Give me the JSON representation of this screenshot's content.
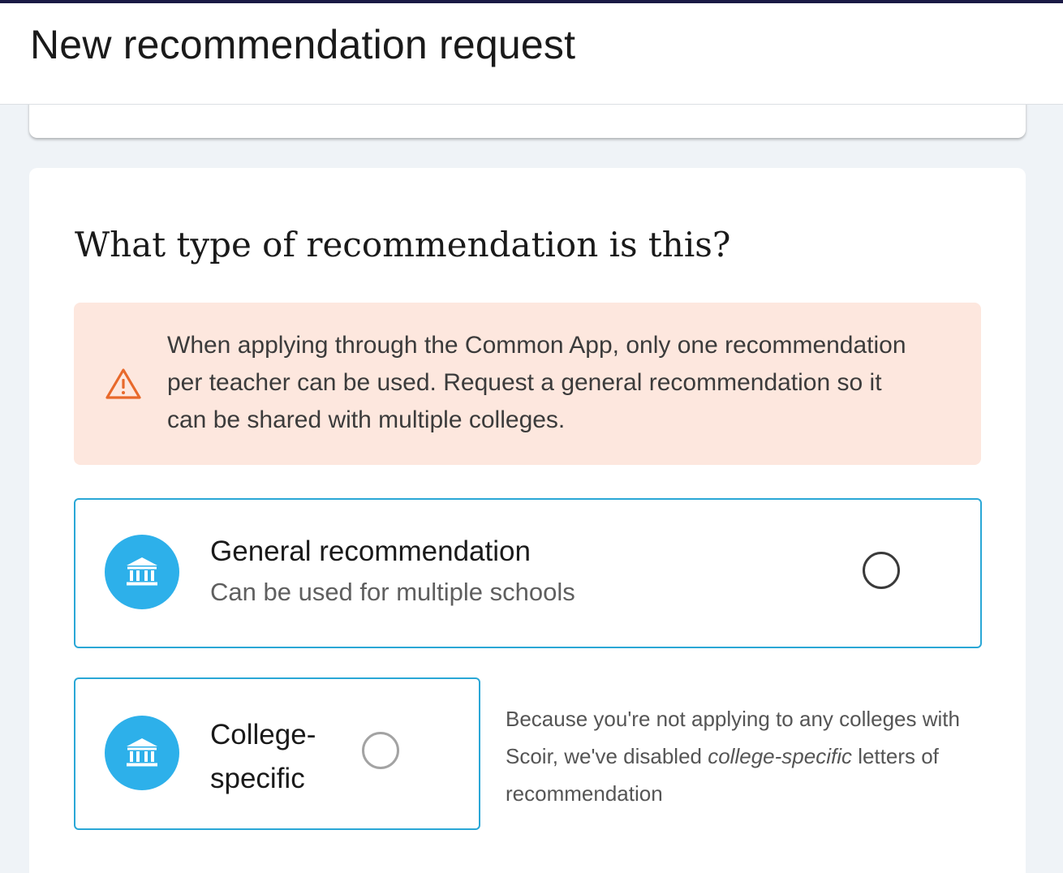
{
  "header": {
    "title": "New recommendation request"
  },
  "question": {
    "title": "What type of recommendation is this?"
  },
  "warning": {
    "icon": "warning-icon",
    "text": "When applying through the Common App, only one recommendation per teacher can be used. Request a general recommendation so it can be shared with multiple colleges."
  },
  "options": {
    "general": {
      "icon": "institution-icon",
      "title": "General recommendation",
      "subtitle": "Can be used for multiple schools",
      "selected": false
    },
    "college_specific": {
      "icon": "institution-icon",
      "title": "College-specific",
      "selected": false,
      "disabled": true,
      "note_part1": "Because you're not applying to any colleges with Scoir, we've disabled ",
      "note_emphasis": "college-specific",
      "note_part2": " letters of recommendation"
    }
  },
  "colors": {
    "accent": "#2db0ea",
    "option_border": "#2aa7d6",
    "warning_bg": "#fde7de",
    "warning_icon": "#e8692b",
    "page_bg": "#eff3f7"
  }
}
